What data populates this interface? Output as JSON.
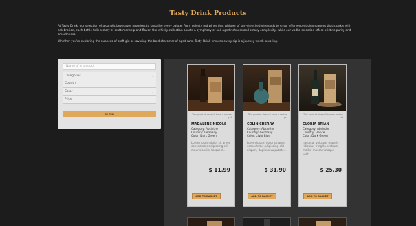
{
  "page": {
    "title": "Tasty Drink Products",
    "intro_1": "At Tasty Drink, our selection of alcoholic beverages promises to tantalize every palate. From velvety red wines that whisper of sun-drenched vineyards to crisp, effervescent champagnes that sparkle with celebration, each bottle tells a story of craftsmanship and flavor. Our whisky collection boasts a symphony of oak-aged richness and smoky complexity, while our vodka selection offers pristine purity and smoothness.",
    "intro_2": "Whether you're exploring the nuances of craft gin or savoring the bold character of aged rum, Tasty Drink ensures every sip is a journey worth savoring."
  },
  "filter": {
    "search_placeholder": "Name of a product",
    "selects": [
      {
        "label": "Categories"
      },
      {
        "label": "Country"
      },
      {
        "label": "Color"
      },
      {
        "label": "Price"
      }
    ],
    "button_label": "FILTER"
  },
  "products": [
    {
      "review": "This product doesn't have a review yet",
      "name": "MADALENE NICOLS",
      "category": "Category: Absinthe",
      "country": "Country: Germany",
      "color": "Color: Dark Green",
      "desc": "Lorem ipsum dolor sit amet consectetur adipiscing elit mauris sociis, torquent...",
      "price": "$ 11.99",
      "basket": "ADD TO BASKET"
    },
    {
      "review": "This product doesn't have a review yet",
      "name": "COLIN CHERRY",
      "category": "Category: Absinthe",
      "country": "Country: Germany",
      "color": "Color: Light Blue",
      "desc": "Lorem ipsum dolor sit amet consectetur adipiscing elit aliquet, dapibus vulputate...",
      "price": "$ 31.90",
      "basket": "ADD TO BASKET"
    },
    {
      "review": "This product doesn't have a review yet",
      "name": "GLORIA BRIAN",
      "category": "Category: Absinthe",
      "country": "Country: France",
      "color": "Color: Dark Green",
      "desc": "nascetur volutpat magnis ridiculus fringilla pretium mollis, massa natoque velit...",
      "price": "$ 25.30",
      "basket": "ADD TO BASKET"
    }
  ],
  "colors": {
    "background": "#1c1c1c",
    "accent": "#e0a85a",
    "panel": "#333333",
    "card": "#dcdcdc"
  }
}
